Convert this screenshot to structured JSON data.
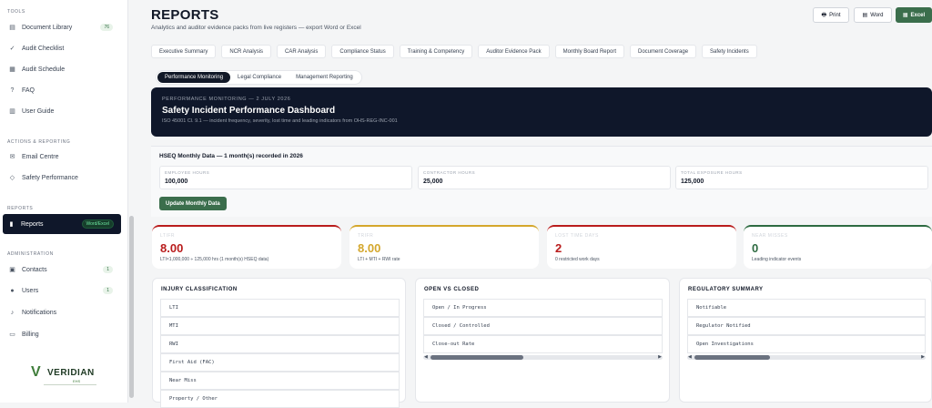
{
  "sidebar": {
    "sections": {
      "tools": "TOOLS",
      "actions": "ACTIONS & REPORTING",
      "reports": "REPORTS",
      "admin": "ADMINISTRATION"
    },
    "items": [
      {
        "label": "Document Library",
        "icon": "document-icon",
        "badge": "76"
      },
      {
        "label": "Audit Checklist",
        "icon": "check-icon",
        "badge": ""
      },
      {
        "label": "Audit Schedule",
        "icon": "calendar-icon",
        "badge": ""
      },
      {
        "label": "FAQ",
        "icon": "question-icon",
        "badge": ""
      },
      {
        "label": "User Guide",
        "icon": "book-icon",
        "badge": ""
      },
      {
        "label": "Email Centre",
        "icon": "mail-icon",
        "badge": ""
      },
      {
        "label": "Safety Performance",
        "icon": "shield-icon",
        "badge": ""
      },
      {
        "label": "Reports",
        "icon": "chart-icon",
        "badge": "Word/Excel"
      },
      {
        "label": "Contacts",
        "icon": "contacts-icon",
        "badge": "1"
      },
      {
        "label": "Users",
        "icon": "users-icon",
        "badge": "1"
      },
      {
        "label": "Notifications",
        "icon": "bell-icon",
        "badge": ""
      },
      {
        "label": "Billing",
        "icon": "card-icon",
        "badge": ""
      }
    ],
    "logo": {
      "name": "VERIDIAN",
      "sub": "EHS"
    }
  },
  "header": {
    "title": "REPORTS",
    "subtitle": "Analytics and auditor evidence packs from live registers — export Word or Excel",
    "print": "Print",
    "word": "Word",
    "excel": "Excel"
  },
  "tabs": [
    "Executive Summary",
    "NCR Analysis",
    "CAR Analysis",
    "Compliance Status",
    "Training & Competency",
    "Auditor Evidence Pack",
    "Monthly Board Report",
    "Document Coverage",
    "Safety Incidents"
  ],
  "subtabs": [
    "Performance Monitoring",
    "Legal Compliance",
    "Management Reporting"
  ],
  "hero": {
    "kicker": "PERFORMANCE MONITORING — 2 JULY 2026",
    "title": "Safety Incident Performance Dashboard",
    "desc": "ISO 45001 Cl. 9.1 — incident frequency, severity, lost time and leading indicators from OHS-REG-INC-001"
  },
  "hseq": {
    "title": "HSEQ Monthly Data — 1 month(s) recorded in 2026",
    "employee_label": "EMPLOYEE HOURS",
    "employee_value": "100,000",
    "contractor_label": "CONTRACTOR HOURS",
    "contractor_value": "25,000",
    "total_label": "TOTAL EXPOSURE HOURS",
    "total_value": "125,000",
    "update_button": "Update Monthly Data"
  },
  "kpis": [
    {
      "label": "LTIFR",
      "value": "8.00",
      "sub": "LTI×1,000,000 ÷ 125,000 hrs (1 month(s) HSEQ data)",
      "color": "#b91c1c"
    },
    {
      "label": "TRIFR",
      "value": "8.00",
      "sub": "LTI + MTI + RWI rate",
      "color": "#d4a72c"
    },
    {
      "label": "LOST TIME DAYS",
      "value": "2",
      "sub": "0 restricted work days",
      "color": "#b91c1c"
    },
    {
      "label": "NEAR MISSES",
      "value": "0",
      "sub": "Leading indicator events",
      "color": "#2e6b41"
    }
  ],
  "panels": {
    "injury": {
      "title": "INJURY CLASSIFICATION",
      "rows": [
        "LTI",
        "MTI",
        "RWI",
        "First Aid (FAC)",
        "Near Miss",
        "Property / Other"
      ]
    },
    "open": {
      "title": "OPEN VS CLOSED",
      "rows": [
        "Open / In Progress",
        "Closed / Controlled",
        "Close-out Rate"
      ]
    },
    "reg": {
      "title": "REGULATORY SUMMARY",
      "rows": [
        "Notifiable",
        "Regulator Notified",
        "Open Investigations"
      ]
    }
  }
}
